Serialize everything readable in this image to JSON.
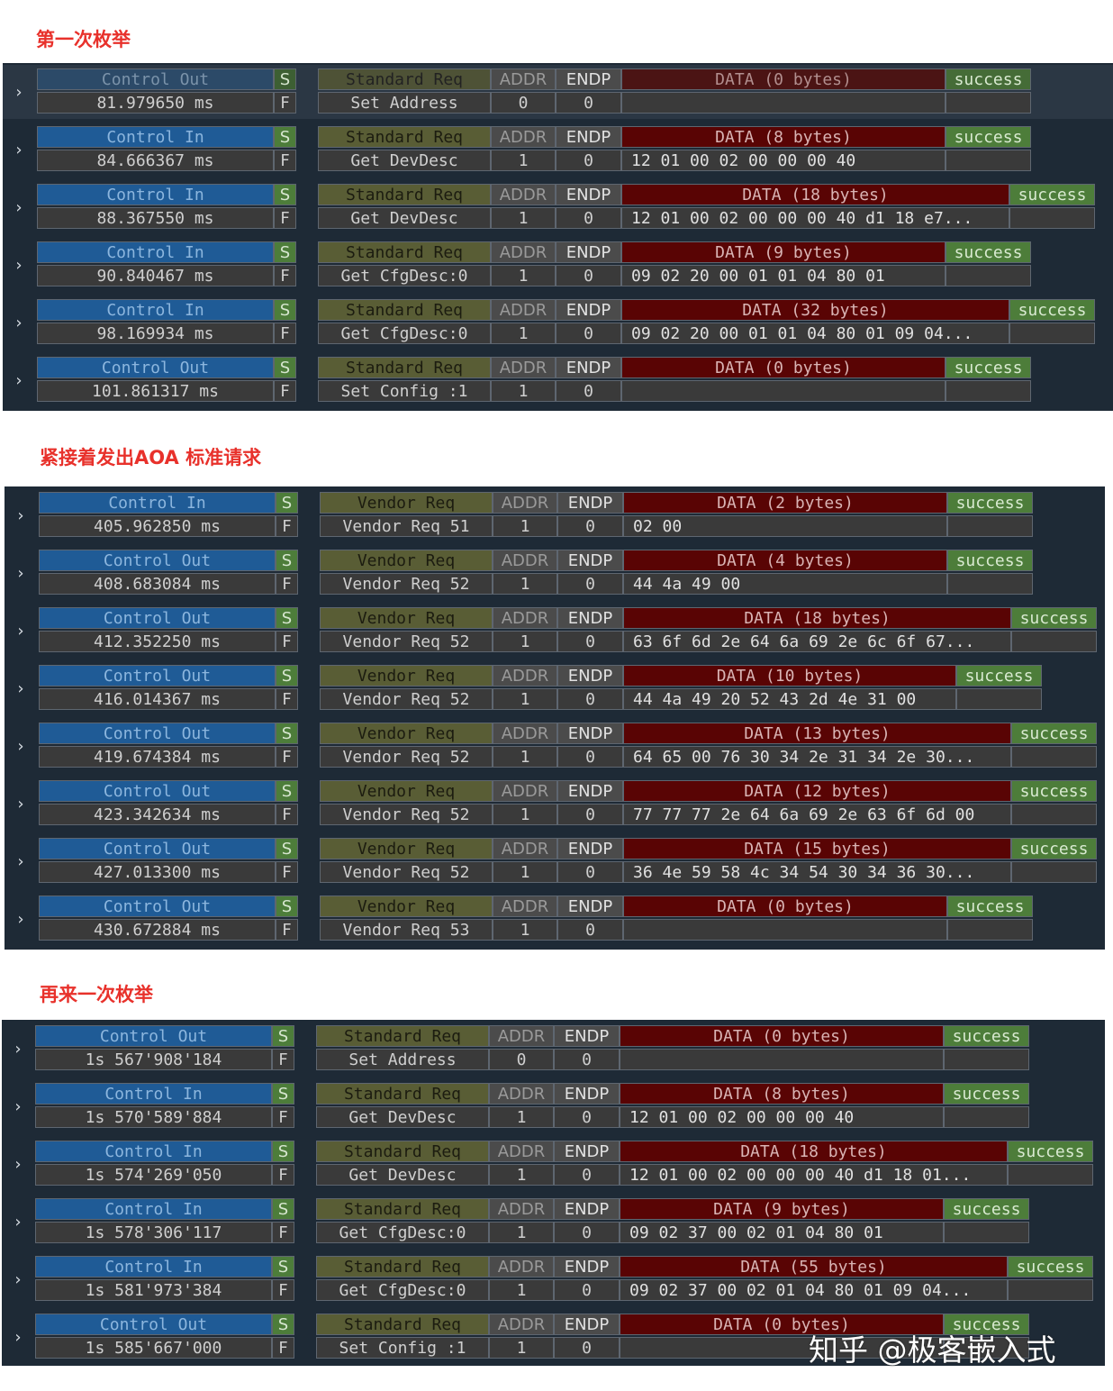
{
  "sections": [
    {
      "heading": "第一次枚举",
      "rows": [
        {
          "type": "Control Out",
          "time": "81.979650 ms",
          "s": "S",
          "f": "F",
          "req_type": "Standard Req",
          "req": "Set Address",
          "addr_label": "ADDR",
          "addr": "0",
          "endp_label": "ENDP",
          "endp": "0",
          "data_header": "DATA (0 bytes)",
          "data": "",
          "status": "success"
        },
        {
          "type": "Control In",
          "time": "84.666367 ms",
          "s": "S",
          "f": "F",
          "req_type": "Standard Req",
          "req": "Get DevDesc",
          "addr_label": "ADDR",
          "addr": "1",
          "endp_label": "ENDP",
          "endp": "0",
          "data_header": "DATA (8 bytes)",
          "data": "12 01 00 02 00 00 00 40",
          "status": "success"
        },
        {
          "type": "Control In",
          "time": "88.367550 ms",
          "s": "S",
          "f": "F",
          "req_type": "Standard Req",
          "req": "Get DevDesc",
          "addr_label": "ADDR",
          "addr": "1",
          "endp_label": "ENDP",
          "endp": "0",
          "data_header": "DATA (18 bytes)",
          "data": "12 01 00 02 00 00 00 40 d1 18 e7...",
          "status": "success"
        },
        {
          "type": "Control In",
          "time": "90.840467 ms",
          "s": "S",
          "f": "F",
          "req_type": "Standard Req",
          "req": "Get CfgDesc:0",
          "addr_label": "ADDR",
          "addr": "1",
          "endp_label": "ENDP",
          "endp": "0",
          "data_header": "DATA (9 bytes)",
          "data": "09 02 20 00 01 01 04 80 01",
          "status": "success"
        },
        {
          "type": "Control In",
          "time": "98.169934 ms",
          "s": "S",
          "f": "F",
          "req_type": "Standard Req",
          "req": "Get CfgDesc:0",
          "addr_label": "ADDR",
          "addr": "1",
          "endp_label": "ENDP",
          "endp": "0",
          "data_header": "DATA (32 bytes)",
          "data": "09 02 20 00 01 01 04 80 01 09 04...",
          "status": "success"
        },
        {
          "type": "Control Out",
          "time": "101.861317 ms",
          "s": "S",
          "f": "F",
          "req_type": "Standard Req",
          "req": "Set Config :1",
          "addr_label": "ADDR",
          "addr": "1",
          "endp_label": "ENDP",
          "endp": "0",
          "data_header": "DATA (0 bytes)",
          "data": "",
          "status": "success"
        }
      ]
    },
    {
      "heading": "紧接着发出AOA 标准请求",
      "rows": [
        {
          "type": "Control In",
          "time": "405.962850 ms",
          "s": "S",
          "f": "F",
          "req_type": "Vendor Req",
          "req": "Vendor Req 51",
          "addr_label": "ADDR",
          "addr": "1",
          "endp_label": "ENDP",
          "endp": "0",
          "data_header": "DATA (2 bytes)",
          "data": "02 00",
          "status": "success"
        },
        {
          "type": "Control Out",
          "time": "408.683084 ms",
          "s": "S",
          "f": "F",
          "req_type": "Vendor Req",
          "req": "Vendor Req 52",
          "addr_label": "ADDR",
          "addr": "1",
          "endp_label": "ENDP",
          "endp": "0",
          "data_header": "DATA (4 bytes)",
          "data": "44 4a 49 00",
          "status": "success"
        },
        {
          "type": "Control Out",
          "time": "412.352250 ms",
          "s": "S",
          "f": "F",
          "req_type": "Vendor Req",
          "req": "Vendor Req 52",
          "addr_label": "ADDR",
          "addr": "1",
          "endp_label": "ENDP",
          "endp": "0",
          "data_header": "DATA (18 bytes)",
          "data": "63 6f 6d 2e 64 6a 69 2e 6c 6f 67...",
          "status": "success"
        },
        {
          "type": "Control Out",
          "time": "416.014367 ms",
          "s": "S",
          "f": "F",
          "req_type": "Vendor Req",
          "req": "Vendor Req 52",
          "addr_label": "ADDR",
          "addr": "1",
          "endp_label": "ENDP",
          "endp": "0",
          "data_header": "DATA (10 bytes)",
          "data": "44 4a 49 20 52 43 2d 4e 31 00",
          "status": "success"
        },
        {
          "type": "Control Out",
          "time": "419.674384 ms",
          "s": "S",
          "f": "F",
          "req_type": "Vendor Req",
          "req": "Vendor Req 52",
          "addr_label": "ADDR",
          "addr": "1",
          "endp_label": "ENDP",
          "endp": "0",
          "data_header": "DATA (13 bytes)",
          "data": "64 65 00 76 30 34 2e 31 34 2e 30...",
          "status": "success"
        },
        {
          "type": "Control Out",
          "time": "423.342634 ms",
          "s": "S",
          "f": "F",
          "req_type": "Vendor Req",
          "req": "Vendor Req 52",
          "addr_label": "ADDR",
          "addr": "1",
          "endp_label": "ENDP",
          "endp": "0",
          "data_header": "DATA (12 bytes)",
          "data": "77 77 77 2e 64 6a 69 2e 63 6f 6d 00",
          "status": "success"
        },
        {
          "type": "Control Out",
          "time": "427.013300 ms",
          "s": "S",
          "f": "F",
          "req_type": "Vendor Req",
          "req": "Vendor Req 52",
          "addr_label": "ADDR",
          "addr": "1",
          "endp_label": "ENDP",
          "endp": "0",
          "data_header": "DATA (15 bytes)",
          "data": "36 4e 59 58 4c 34 54 30 34 36 30...",
          "status": "success"
        },
        {
          "type": "Control Out",
          "time": "430.672884 ms",
          "s": "S",
          "f": "F",
          "req_type": "Vendor Req",
          "req": "Vendor Req 53",
          "addr_label": "ADDR",
          "addr": "1",
          "endp_label": "ENDP",
          "endp": "0",
          "data_header": "DATA (0 bytes)",
          "data": "",
          "status": "success"
        }
      ]
    },
    {
      "heading": "再来一次枚举",
      "rows": [
        {
          "type": "Control Out",
          "time": "1s 567'908'184",
          "s": "S",
          "f": "F",
          "req_type": "Standard Req",
          "req": "Set Address",
          "addr_label": "ADDR",
          "addr": "0",
          "endp_label": "ENDP",
          "endp": "0",
          "data_header": "DATA (0 bytes)",
          "data": "",
          "status": "success"
        },
        {
          "type": "Control In",
          "time": "1s 570'589'884",
          "s": "S",
          "f": "F",
          "req_type": "Standard Req",
          "req": "Get DevDesc",
          "addr_label": "ADDR",
          "addr": "1",
          "endp_label": "ENDP",
          "endp": "0",
          "data_header": "DATA (8 bytes)",
          "data": "12 01 00 02 00 00 00 40",
          "status": "success"
        },
        {
          "type": "Control In",
          "time": "1s 574'269'050",
          "s": "S",
          "f": "F",
          "req_type": "Standard Req",
          "req": "Get DevDesc",
          "addr_label": "ADDR",
          "addr": "1",
          "endp_label": "ENDP",
          "endp": "0",
          "data_header": "DATA (18 bytes)",
          "data": "12 01 00 02 00 00 00 40 d1 18 01...",
          "status": "success"
        },
        {
          "type": "Control In",
          "time": "1s 578'306'117",
          "s": "S",
          "f": "F",
          "req_type": "Standard Req",
          "req": "Get CfgDesc:0",
          "addr_label": "ADDR",
          "addr": "1",
          "endp_label": "ENDP",
          "endp": "0",
          "data_header": "DATA (9 bytes)",
          "data": "09 02 37 00 02 01 04 80 01",
          "status": "success"
        },
        {
          "type": "Control In",
          "time": "1s 581'973'384",
          "s": "S",
          "f": "F",
          "req_type": "Standard Req",
          "req": "Get CfgDesc:0",
          "addr_label": "ADDR",
          "addr": "1",
          "endp_label": "ENDP",
          "endp": "0",
          "data_header": "DATA (55 bytes)",
          "data": "09 02 37 00 02 01 04 80 01 09 04...",
          "status": "success"
        },
        {
          "type": "Control Out",
          "time": "1s 585'667'000",
          "s": "S",
          "f": "F",
          "req_type": "Standard Req",
          "req": "Set Config :1",
          "addr_label": "ADDR",
          "addr": "1",
          "endp_label": "ENDP",
          "endp": "0",
          "data_header": "DATA (0 bytes)",
          "data": "",
          "status": "success"
        }
      ]
    }
  ],
  "watermark": "知乎 @极客嵌入式",
  "colors": {
    "heading": "#e8312b",
    "panel_bg": "#1e2a36",
    "control_type": "#1f5b96",
    "request_type": "#595d35",
    "data_header": "#590404",
    "success": "#4d7d3a"
  }
}
